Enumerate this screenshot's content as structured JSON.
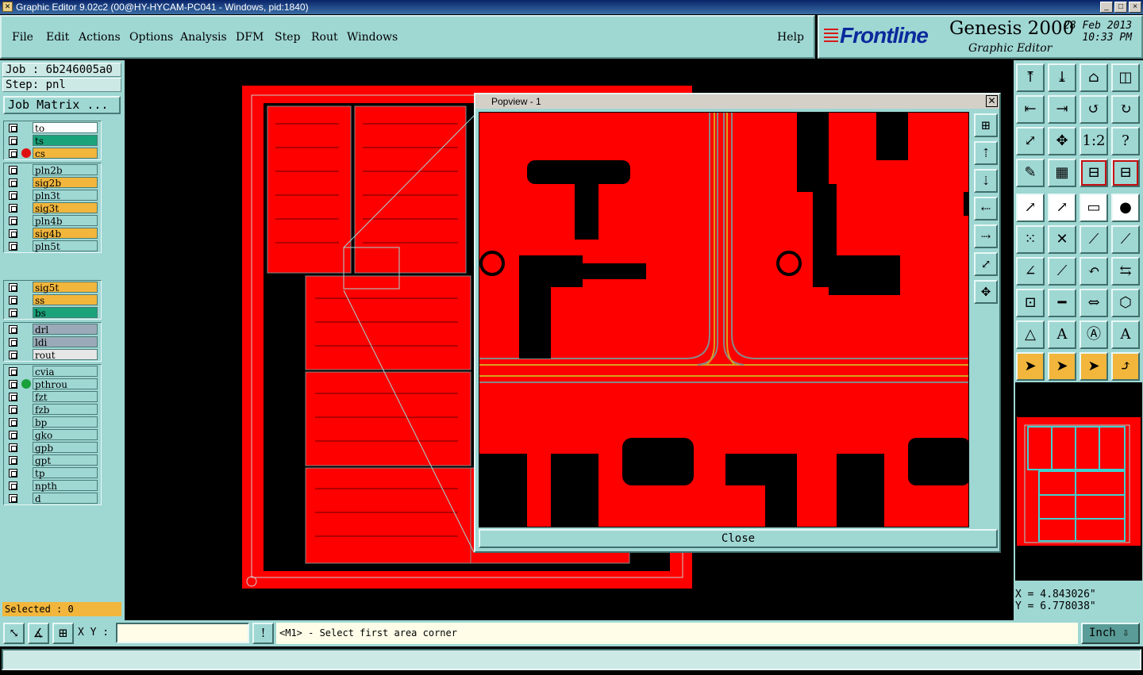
{
  "window": {
    "title": "Graphic Editor 9.02c2 (00@HY-HYCAM-PC041 - Windows, pid:1840)",
    "buttons": [
      "_",
      "□",
      "×"
    ]
  },
  "menu": [
    "File",
    "Edit",
    "Actions",
    "Options",
    "Analysis",
    "DFM",
    "Step",
    "Rout",
    "Windows"
  ],
  "help": "Help",
  "brand": {
    "logo": "Frontline",
    "product": "Genesis 2000",
    "subtitle": "Graphic Editor",
    "date": "28 Feb 2013",
    "time": "10:33 PM"
  },
  "job": {
    "job_line": "Job : 6b246005a0",
    "step_line": "Step: pnl",
    "matrix_button": "Job Matrix ..."
  },
  "layers": {
    "group1": [
      {
        "name": "to",
        "color": "#ffffff",
        "dot": ""
      },
      {
        "name": "ts",
        "color": "#1aa37a",
        "dot": ""
      },
      {
        "name": "cs",
        "color": "#f2b63c",
        "dot": "#e01010"
      }
    ],
    "group2": [
      {
        "name": "pln2b",
        "color": "#9fd7d3"
      },
      {
        "name": "sig2b",
        "color": "#f2b63c"
      },
      {
        "name": "pln3t",
        "color": "#9fd7d3"
      },
      {
        "name": "sig3t",
        "color": "#f2b63c"
      },
      {
        "name": "pln4b",
        "color": "#9fd7d3"
      },
      {
        "name": "sig4b",
        "color": "#f2b63c"
      },
      {
        "name": "pln5t",
        "color": "#9fd7d3"
      }
    ],
    "group3": [
      {
        "name": "sig5t",
        "color": "#f2b63c"
      },
      {
        "name": "ss",
        "color": "#f2b63c"
      },
      {
        "name": "bs",
        "color": "#1aa37a"
      }
    ],
    "group4": [
      {
        "name": "drl",
        "color": "#9aaab8"
      },
      {
        "name": "ldi",
        "color": "#9aaab8"
      },
      {
        "name": "rout",
        "color": "#e6e6e6"
      }
    ],
    "group5": [
      {
        "name": "cvia",
        "color": "#9fd7d3",
        "dot": ""
      },
      {
        "name": "pthrou",
        "color": "#9fd7d3",
        "dot": "#1aa03a"
      },
      {
        "name": "fzt",
        "color": "#9fd7d3",
        "dot": ""
      },
      {
        "name": "fzb",
        "color": "#9fd7d3",
        "dot": ""
      },
      {
        "name": "bp",
        "color": "#9fd7d3",
        "dot": ""
      },
      {
        "name": "gko",
        "color": "#9fd7d3",
        "dot": ""
      },
      {
        "name": "gpb",
        "color": "#9fd7d3",
        "dot": ""
      },
      {
        "name": "gpt",
        "color": "#9fd7d3",
        "dot": ""
      },
      {
        "name": "tp",
        "color": "#9fd7d3",
        "dot": ""
      },
      {
        "name": "npth",
        "color": "#9fd7d3",
        "dot": ""
      },
      {
        "name": "d",
        "color": "#9fd7d3",
        "dot": ""
      }
    ]
  },
  "selected": "Selected : 0",
  "popup": {
    "title": "Popview - 1",
    "close": "Close"
  },
  "toolbar_icons": [
    "zoom-home-icon",
    "zoom-in-icon",
    "home-icon",
    "split-view-icon",
    "pan-left-icon",
    "pan-right-icon",
    "undo-view-icon",
    "redo-view-icon",
    "fit-screen-icon",
    "zoom-fit-icon",
    "ratio-icon",
    "help-icon",
    "measure-icon",
    "grid-icon",
    "layers-red-icon",
    "layers-blue-icon",
    "draw-icon",
    "draw-red-icon",
    "ruler-icon",
    "circle-icon",
    "move-icon",
    "cross-icon",
    "line-icon",
    "arrow-icon",
    "angle-icon",
    "slash-icon",
    "rotate-icon",
    "mirror-icon",
    "snap-icon",
    "minus-icon",
    "resize-icon",
    "shapes-icon",
    "triangle-icon",
    "a-icon",
    "a-box-icon",
    "a-arrow-icon",
    "pointer-icon",
    "pointer-box-icon",
    "pointer-select-icon",
    "pointer-route-icon"
  ],
  "coords": {
    "x": "X = 4.843026\"",
    "y": "Y = 6.778038\""
  },
  "bottom": {
    "xy_label": "X Y :",
    "xy_value": "",
    "prompt": "<M1> - Select first area corner",
    "unit": "Inch",
    "warn": "!"
  }
}
